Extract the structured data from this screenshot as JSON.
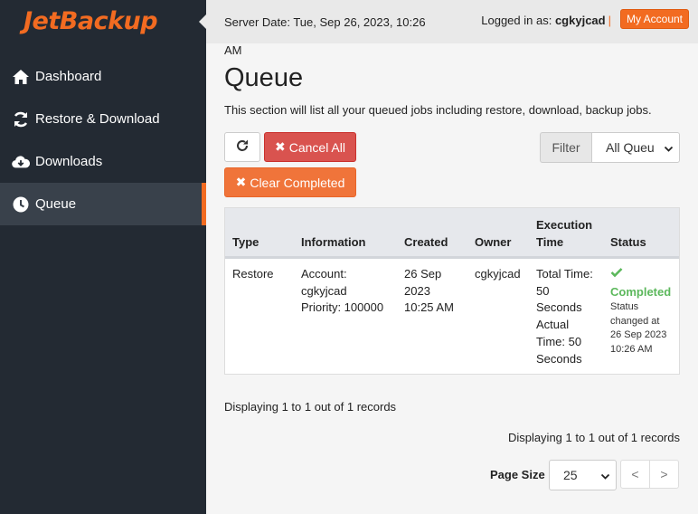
{
  "app": {
    "logo_text": "JetBackup",
    "brand_color": "#f26b21"
  },
  "sidebar": {
    "items": [
      {
        "label": "Dashboard",
        "icon": "home-icon",
        "active": false
      },
      {
        "label": "Restore & Download",
        "icon": "refresh-icon",
        "active": false
      },
      {
        "label": "Downloads",
        "icon": "cloud-download-icon",
        "active": false
      },
      {
        "label": "Queue",
        "icon": "clock-icon",
        "active": true
      }
    ]
  },
  "header": {
    "server_date_line1": "Server Date: Tue, Sep 26, 2023, 10:26",
    "server_date_line2": "AM",
    "logged_in_prefix": "Logged in as:",
    "username": "cgkyjcad",
    "separator": "|",
    "my_account_label": "My Account"
  },
  "main": {
    "title": "Queue",
    "description": "This section will list all your queued jobs including restore, download, backup jobs.",
    "refresh_icon": "refresh-icon",
    "cancel_all_label": "Cancel All",
    "clear_completed_label": "Clear Completed",
    "filter_label": "Filter",
    "filter_value": "All Queu"
  },
  "table": {
    "headers": {
      "type": "Type",
      "information": "Information",
      "created": "Created",
      "owner": "Owner",
      "execution_time_1": "Execution",
      "execution_time_2": "Time",
      "status": "Status"
    },
    "row": {
      "type": "Restore",
      "info_1": "Account:",
      "info_2": "cgkyjcad",
      "info_3": "Priority: 100000",
      "created_1": "26 Sep",
      "created_2": "2023",
      "created_3": "10:25 AM",
      "owner": "cgkyjcad",
      "exec_1": "Total Time:",
      "exec_2": "50",
      "exec_3": "Seconds",
      "exec_4": "Actual",
      "exec_5": "Time: 50",
      "exec_6": "Seconds",
      "status_icon": "check-icon",
      "status": "Completed",
      "status_color": "#5cb85c",
      "status_sub_1": "Status",
      "status_sub_2": "changed at",
      "status_sub_3": "26 Sep 2023",
      "status_sub_4": "10:26 AM"
    }
  },
  "footer": {
    "displaying_top": "Displaying 1 to 1 out of 1 records",
    "displaying_bottom": "Displaying 1 to 1 out of 1 records",
    "page_size_label": "Page Size",
    "page_size_value": "25",
    "prev_label": "<",
    "next_label": ">"
  }
}
